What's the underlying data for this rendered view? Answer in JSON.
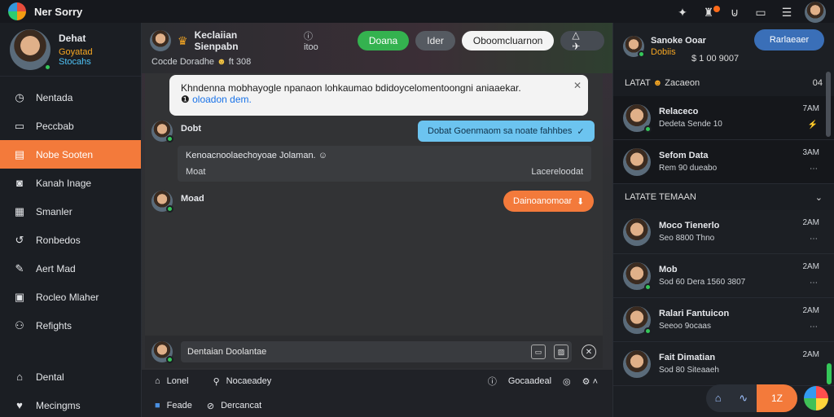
{
  "app": {
    "title": "Ner Sorry"
  },
  "profile": {
    "name": "Dehat",
    "sub1": "Goyatad",
    "sub2": "Stocahs"
  },
  "sidebar": {
    "items": [
      {
        "label": "Nentada",
        "icon": "clock-icon"
      },
      {
        "label": "Peccbab",
        "icon": "card-icon"
      },
      {
        "label": "Nobe Sooten",
        "icon": "chat-icon",
        "active": true
      },
      {
        "label": "Kanah Inage",
        "icon": "image-icon"
      },
      {
        "label": "Smanler",
        "icon": "calendar-icon"
      },
      {
        "label": "Ronbedos",
        "icon": "history-icon"
      },
      {
        "label": "Aert Mad",
        "icon": "pen-icon"
      },
      {
        "label": "Rocleo Mlaher",
        "icon": "doc-icon"
      },
      {
        "label": "Refights",
        "icon": "users-icon"
      }
    ],
    "bottom": [
      {
        "label": "Dental",
        "icon": "home-icon"
      },
      {
        "label": "Mecingms",
        "icon": "heart-icon"
      }
    ]
  },
  "header": {
    "title": "Keclaiian Sienpabn",
    "tag": "ⓘ itoo",
    "sub": "Cocde Doradhe",
    "sub_tail": "ft 308",
    "btn_green": "Doana",
    "btn_gray": "Ider",
    "btn_white": "Oboomcluarnon"
  },
  "tooltip": {
    "text": "Khndenna mobhayogle npanaon lohkaumao bdidoycelomentoongni aniaaekar.",
    "link": "oloadon dem."
  },
  "messages": {
    "m1_name": "Dobt",
    "m1_bubble": "Dobat Goenmaom sa noate fahhbes",
    "card_text": "Kenoacnoolaechoyoae Jolaman.",
    "card_left": "Moat",
    "card_right": "Lacereloodat",
    "m2_name": "Moad",
    "m2_bubble": "Dainoanomoar"
  },
  "composer": {
    "placeholder": "Dentaian Doolantae"
  },
  "bottom_bar": {
    "home": "Lonel",
    "search": "Nocaeadey",
    "status": "Gocaadeal",
    "badge": "Feade",
    "link": "Dercancat"
  },
  "rpanel": {
    "user_name": "Sanoke Ooar",
    "user_sub": "Dobiis",
    "user_num": "$ 1 00 9007",
    "button": "Rarlaeaer",
    "section1": "LATAT",
    "section1_sub": "Zacaeon",
    "section1_count": "04",
    "section2": "LATATE TEMAAN",
    "friends_top": [
      {
        "name": "Relaceco",
        "sub": "Dedeta Sende 10",
        "time": "7AM",
        "act": "⚡"
      },
      {
        "name": "Sefom Data",
        "sub": "Rem 90 dueabo",
        "time": "3AM",
        "act": "⋯"
      }
    ],
    "friends": [
      {
        "name": "Moco Tienerlo",
        "sub": "Seo 8800 Thno",
        "time": "2AM",
        "act": "⋯"
      },
      {
        "name": "Mob",
        "sub": "Sod 60 Dera 1560 3807",
        "time": "2AM",
        "act": "⋯"
      },
      {
        "name": "Ralari Fantuicon",
        "sub": "Seeoo 9ocaas",
        "time": "2AM",
        "act": "⋯"
      },
      {
        "name": "Fait Dimatian",
        "sub": "Sod 80 Siteaaeh",
        "time": "2AM",
        "act": "⋯"
      }
    ],
    "footer_right": "1Z"
  }
}
